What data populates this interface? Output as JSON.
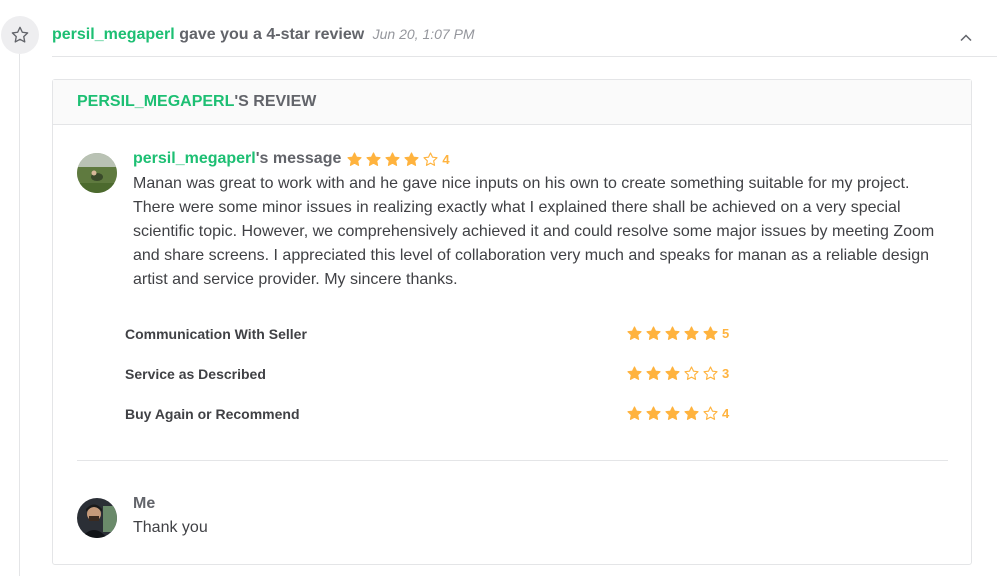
{
  "event": {
    "icon": "star-outline-icon",
    "username": "persil_megaperl",
    "action": "gave you a 4-star review",
    "date": "Jun 20, 1:07 PM",
    "collapse_icon": "chevron-up-icon"
  },
  "review": {
    "title_user": "PERSIL_MEGAPERL",
    "title_suffix": "'S REVIEW",
    "message": {
      "username": "persil_megaperl",
      "label": "'s message",
      "rating": 4,
      "rating_text": "4",
      "body": "Manan was great to work with and he gave nice inputs on his own to create something suitable for my project. There were some minor issues in realizing exactly what I explained there shall be achieved on a very special scientific topic. However, we comprehensively achieved it and could resolve some major issues by meeting Zoom and share screens. I appreciated this level of collaboration very much and speaks for manan as a reliable design artist and service provider. My sincere thanks."
    },
    "criteria": [
      {
        "label": "Communication With Seller",
        "rating": 5,
        "rating_text": "5"
      },
      {
        "label": "Service as Described",
        "rating": 3,
        "rating_text": "3"
      },
      {
        "label": "Buy Again or Recommend",
        "rating": 4,
        "rating_text": "4"
      }
    ],
    "reply": {
      "name": "Me",
      "text": "Thank you"
    }
  },
  "colors": {
    "accent_green": "#1dbf73",
    "star_gold": "#ffb33e",
    "text_dark": "#404145",
    "text_muted": "#62646a"
  }
}
